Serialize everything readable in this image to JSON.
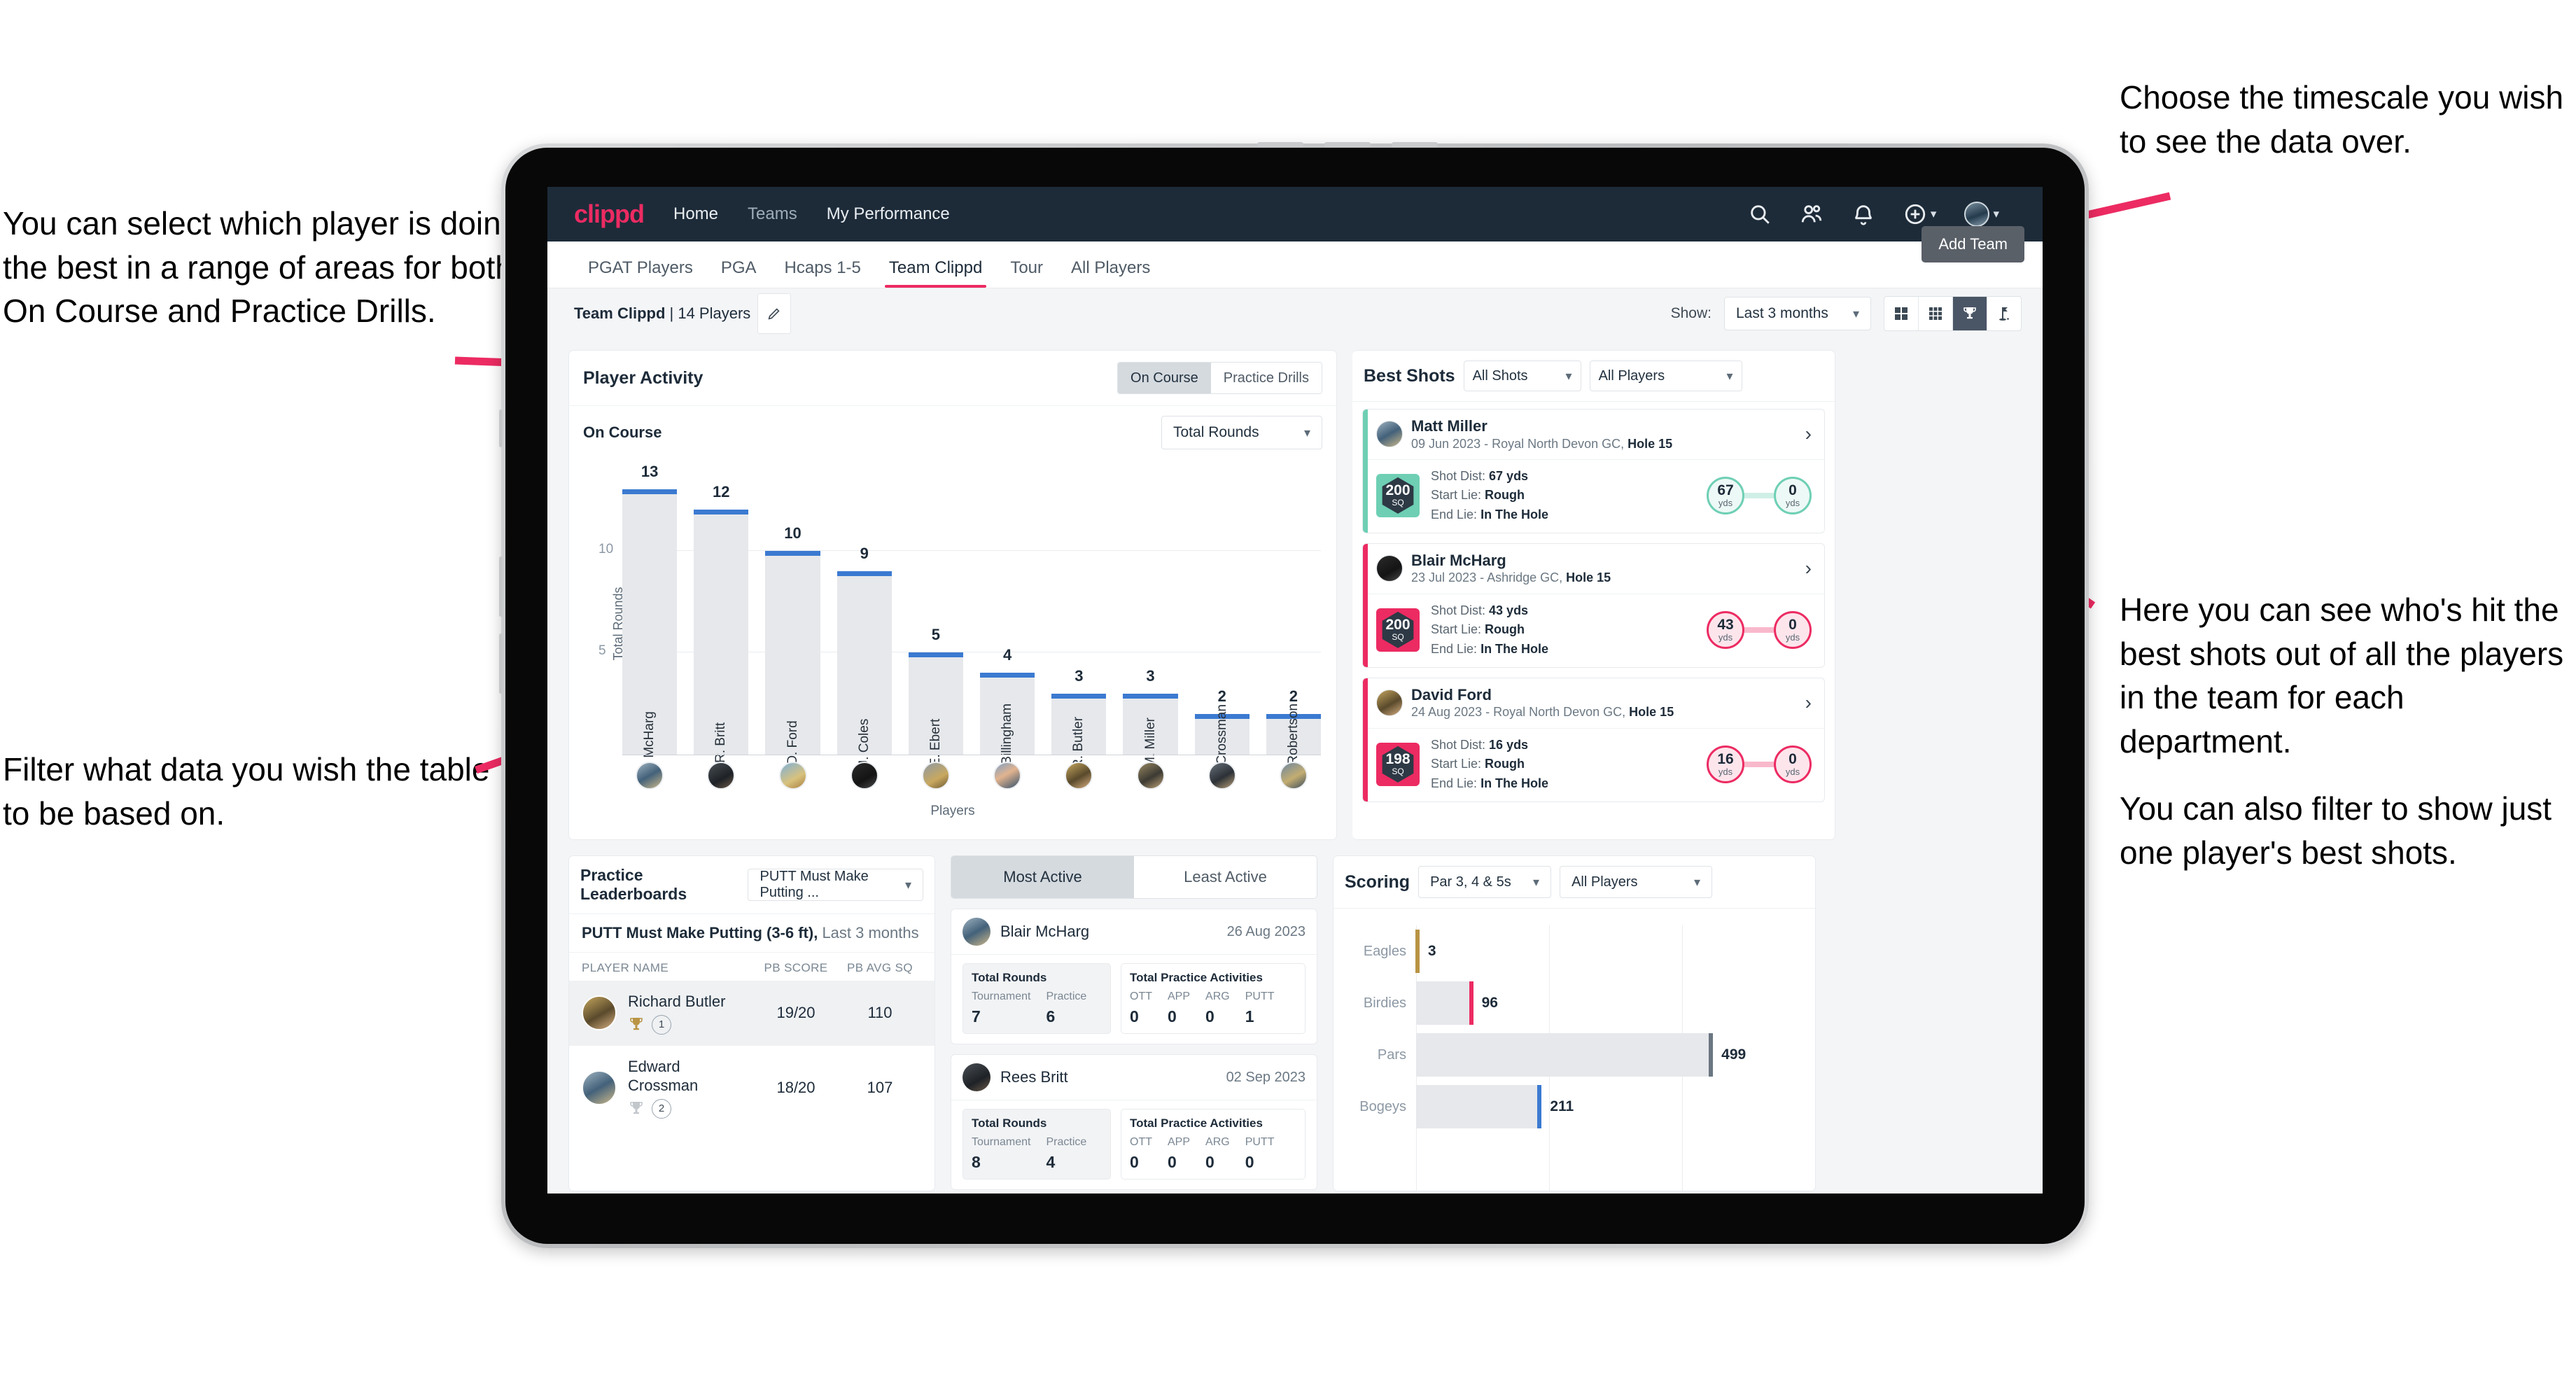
{
  "annotations": {
    "top_left": "You can select which player is doing the best in a range of areas for both On Course and Practice Drills.",
    "bottom_left": "Filter what data you wish the table to be based on.",
    "top_right": "Choose the timescale you wish to see the data over.",
    "right": "Here you can see who's hit the best shots out of all the players in the team for each department.",
    "right2": "You can also filter to show just one player's best shots."
  },
  "colors": {
    "brand_pink": "#ec2b62",
    "navy": "#1d2b39",
    "bar_blue": "#3b7ad1",
    "teal": "#6ecfb4",
    "gold": "#b99444"
  },
  "topnav": {
    "logo": "clippd",
    "links": [
      {
        "label": "Home",
        "active": true
      },
      {
        "label": "Teams",
        "active": false
      },
      {
        "label": "My Performance",
        "active": false
      }
    ],
    "icons": [
      "search-icon",
      "people-icon",
      "bell-icon",
      "plus-circle-icon",
      "avatar"
    ]
  },
  "subnav": {
    "tabs": [
      {
        "label": "PGAT Players",
        "active": false
      },
      {
        "label": "PGA",
        "active": false
      },
      {
        "label": "Hcaps 1-5",
        "active": false
      },
      {
        "label": "Team Clippd",
        "active": true
      },
      {
        "label": "Tour",
        "active": false
      },
      {
        "label": "All Players",
        "active": false
      }
    ],
    "add_team": "Add Team"
  },
  "toolbar": {
    "team_name": "Team Clippd",
    "team_count": "| 14 Players",
    "show_label": "Show:",
    "timescale": "Last 3 months",
    "views": [
      {
        "icon": "grid-2x2-icon",
        "active": false
      },
      {
        "icon": "grid-3x3-icon",
        "active": false
      },
      {
        "icon": "trophy-icon",
        "active": true
      },
      {
        "icon": "golf-flag-icon",
        "active": false
      }
    ]
  },
  "player_activity": {
    "title": "Player Activity",
    "segments": [
      {
        "label": "On Course",
        "active": true
      },
      {
        "label": "Practice Drills",
        "active": false
      }
    ],
    "sub_label": "On Course",
    "metric": "Total Rounds"
  },
  "chart_data": [
    {
      "type": "bar",
      "title": "On Course",
      "xlabel": "Players",
      "ylabel": "Total Rounds",
      "ylim": [
        0,
        14
      ],
      "yticks": [
        5,
        10
      ],
      "grid": true,
      "categories": [
        "B. McHarg",
        "R. Britt",
        "D. Ford",
        "J. Coles",
        "E. Ebert",
        "D. Billingham",
        "R. Butler",
        "M. Miller",
        "E. Crossman",
        "C. Robertson"
      ],
      "values": [
        13,
        12,
        10,
        9,
        5,
        4,
        3,
        3,
        2,
        2
      ]
    },
    {
      "type": "bar",
      "orientation": "horizontal",
      "title": "Scoring",
      "categories": [
        "Eagles",
        "Birdies",
        "Pars",
        "Bogeys"
      ],
      "values": [
        3,
        96,
        499,
        211
      ],
      "colors": [
        "#b99444",
        "#ec2b62",
        "#6b7683",
        "#3b7ad1"
      ],
      "xlim": [
        0,
        640
      ],
      "grid": true
    }
  ],
  "best_shots": {
    "title": "Best Shots",
    "filter_shots": "All Shots",
    "filter_players": "All Players",
    "shots": [
      {
        "player": "Matt Miller",
        "meta_date": "09 Jun 2023 - Royal North Devon GC,",
        "meta_hole": "Hole 15",
        "sq": "200",
        "sq_unit": "SQ",
        "accent": "#6ecfb4",
        "shot_dist_label": "Shot Dist:",
        "shot_dist": "67 yds",
        "start_lie_label": "Start Lie:",
        "start_lie": "Rough",
        "end_lie_label": "End Lie:",
        "end_lie": "In The Hole",
        "from_val": "67",
        "from_unit": "yds",
        "to_val": "0",
        "to_unit": "yds"
      },
      {
        "player": "Blair McHarg",
        "meta_date": "23 Jul 2023 - Ashridge GC,",
        "meta_hole": "Hole 15",
        "sq": "200",
        "sq_unit": "SQ",
        "accent": "#ec2b62",
        "shot_dist_label": "Shot Dist:",
        "shot_dist": "43 yds",
        "start_lie_label": "Start Lie:",
        "start_lie": "Rough",
        "end_lie_label": "End Lie:",
        "end_lie": "In The Hole",
        "from_val": "43",
        "from_unit": "yds",
        "to_val": "0",
        "to_unit": "yds"
      },
      {
        "player": "David Ford",
        "meta_date": "24 Aug 2023 - Royal North Devon GC,",
        "meta_hole": "Hole 15",
        "sq": "198",
        "sq_unit": "SQ",
        "accent": "#ec2b62",
        "shot_dist_label": "Shot Dist:",
        "shot_dist": "16 yds",
        "start_lie_label": "Start Lie:",
        "start_lie": "Rough",
        "end_lie_label": "End Lie:",
        "end_lie": "In The Hole",
        "from_val": "16",
        "from_unit": "yds",
        "to_val": "0",
        "to_unit": "yds"
      }
    ]
  },
  "practice_leaderboards": {
    "title": "Practice Leaderboards",
    "drill_select": "PUTT Must Make Putting ...",
    "subtitle_bold": "PUTT Must Make Putting (3-6 ft),",
    "subtitle_rest": " Last 3 months",
    "columns": [
      "PLAYER NAME",
      "PB SCORE",
      "PB AVG SQ"
    ],
    "rows": [
      {
        "name": "Richard Butler",
        "rank": "1",
        "trophy": "gold",
        "pb_score": "19/20",
        "pb_avg_sq": "110",
        "highlighted": true
      },
      {
        "name": "Edward Crossman",
        "rank": "2",
        "trophy": "silver",
        "pb_score": "18/20",
        "pb_avg_sq": "107",
        "highlighted": false
      }
    ]
  },
  "activity": {
    "tabs": [
      {
        "label": "Most Active",
        "active": true
      },
      {
        "label": "Least Active",
        "active": false
      }
    ],
    "items": [
      {
        "name": "Blair McHarg",
        "date": "26 Aug 2023",
        "rounds_title": "Total Rounds",
        "rounds": [
          {
            "k": "Tournament",
            "v": "7"
          },
          {
            "k": "Practice",
            "v": "6"
          }
        ],
        "practice_title": "Total Practice Activities",
        "practice": [
          {
            "k": "OTT",
            "v": "0"
          },
          {
            "k": "APP",
            "v": "0"
          },
          {
            "k": "ARG",
            "v": "0"
          },
          {
            "k": "PUTT",
            "v": "1"
          }
        ]
      },
      {
        "name": "Rees Britt",
        "date": "02 Sep 2023",
        "rounds_title": "Total Rounds",
        "rounds": [
          {
            "k": "Tournament",
            "v": "8"
          },
          {
            "k": "Practice",
            "v": "4"
          }
        ],
        "practice_title": "Total Practice Activities",
        "practice": [
          {
            "k": "OTT",
            "v": "0"
          },
          {
            "k": "APP",
            "v": "0"
          },
          {
            "k": "ARG",
            "v": "0"
          },
          {
            "k": "PUTT",
            "v": "0"
          }
        ]
      }
    ]
  },
  "scoring": {
    "title": "Scoring",
    "filter_par": "Par 3, 4 & 5s",
    "filter_players": "All Players"
  }
}
